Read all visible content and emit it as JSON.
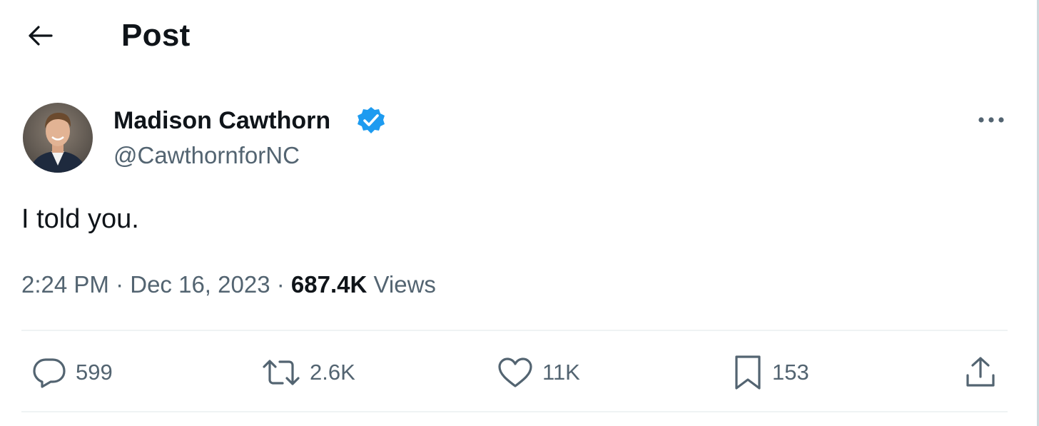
{
  "header": {
    "title": "Post"
  },
  "author": {
    "name": "Madison Cawthorn",
    "handle": "@CawthornforNC",
    "verified": true
  },
  "post": {
    "text": "I told you.",
    "time": "2:24 PM",
    "separator": "·",
    "date": "Dec 16, 2023",
    "views_count": "687.4K",
    "views_label": "Views"
  },
  "actions": {
    "replies": "599",
    "reposts": "2.6K",
    "likes": "11K",
    "bookmarks": "153"
  },
  "colors": {
    "text_primary": "#0f1419",
    "text_secondary": "#536471",
    "verified_blue": "#1d9bf0",
    "divider": "#eff3f4"
  },
  "icons": {
    "back": "arrow-left-icon",
    "verified": "verified-badge-icon",
    "more": "more-horizontal-icon",
    "reply": "reply-icon",
    "repost": "repost-icon",
    "like": "heart-icon",
    "bookmark": "bookmark-icon",
    "share": "share-icon"
  }
}
